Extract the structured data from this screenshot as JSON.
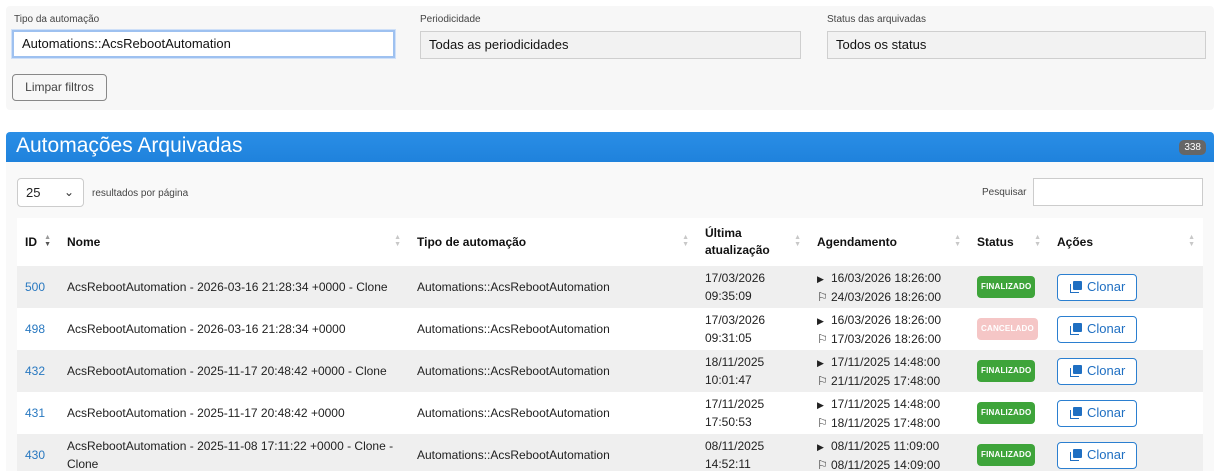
{
  "filters": {
    "tipo_label": "Tipo da automação",
    "tipo_value": "Automations::AcsRebootAutomation",
    "periodicidade_label": "Periodicidade",
    "periodicidade_value": "Todas as periodicidades",
    "status_label": "Status das arquivadas",
    "status_value": "Todos os status",
    "clear_label": "Limpar filtros"
  },
  "panel": {
    "title": "Automações Arquivadas",
    "count": "338",
    "page_length": "25",
    "page_length_label": "resultados por página",
    "search_label": "Pesquisar",
    "search_value": ""
  },
  "table": {
    "headers": {
      "id": "ID",
      "nome": "Nome",
      "tipo": "Tipo de automação",
      "ultima": "Última",
      "ultima2": "atualização",
      "agendamento": "Agendamento",
      "status": "Status",
      "acoes": "Ações"
    },
    "clone_label": "Clonar",
    "rows": [
      {
        "id": "500",
        "nome": "AcsRebootAutomation - 2026-03-16 21:28:34 +0000 - Clone",
        "tipo": "Automations::AcsRebootAutomation",
        "upd_date": "17/03/2026",
        "upd_time": "09:35:09",
        "start": "16/03/2026 18:26:00",
        "end": "24/03/2026 18:26:00",
        "status": "FINALIZADO"
      },
      {
        "id": "498",
        "nome": "AcsRebootAutomation - 2026-03-16 21:28:34 +0000",
        "tipo": "Automations::AcsRebootAutomation",
        "upd_date": "17/03/2026",
        "upd_time": "09:31:05",
        "start": "16/03/2026 18:26:00",
        "end": "17/03/2026 18:26:00",
        "status": "CANCELADO"
      },
      {
        "id": "432",
        "nome": "AcsRebootAutomation - 2025-11-17 20:48:42 +0000 - Clone",
        "tipo": "Automations::AcsRebootAutomation",
        "upd_date": "18/11/2025",
        "upd_time": "10:01:47",
        "start": "17/11/2025 14:48:00",
        "end": "21/11/2025 17:48:00",
        "status": "FINALIZADO"
      },
      {
        "id": "431",
        "nome": "AcsRebootAutomation - 2025-11-17 20:48:42 +0000",
        "tipo": "Automations::AcsRebootAutomation",
        "upd_date": "17/11/2025",
        "upd_time": "17:50:53",
        "start": "17/11/2025 14:48:00",
        "end": "18/11/2025 17:48:00",
        "status": "FINALIZADO"
      },
      {
        "id": "430",
        "nome": "AcsRebootAutomation - 2025-11-08 17:11:22 +0000 - Clone -",
        "nome2": "Clone",
        "tipo": "Automations::AcsRebootAutomation",
        "upd_date": "08/11/2025",
        "upd_time": "14:52:11",
        "start": "08/11/2025 11:09:00",
        "end": "08/11/2025 14:09:00",
        "status": "FINALIZADO"
      }
    ]
  }
}
